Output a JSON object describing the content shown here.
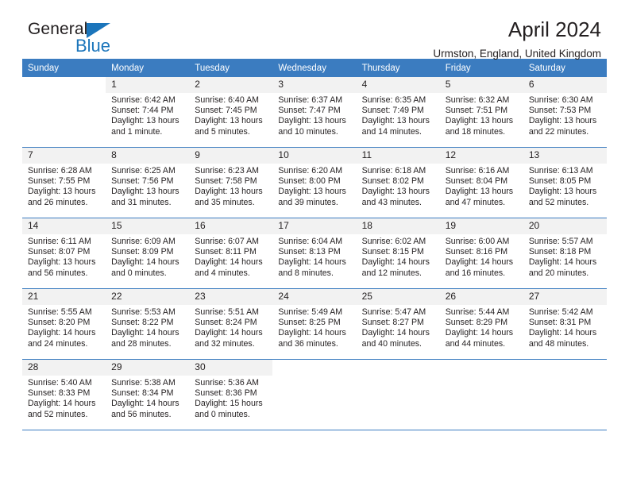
{
  "brand": {
    "name_dark": "General",
    "name_blue": "Blue",
    "accent_color": "#1b75bb"
  },
  "header": {
    "title": "April 2024",
    "subtitle": "Urmston, England, United Kingdom",
    "header_bg": "#3b7cc0",
    "daynum_bg": "#f2f2f2"
  },
  "weekdays": [
    "Sunday",
    "Monday",
    "Tuesday",
    "Wednesday",
    "Thursday",
    "Friday",
    "Saturday"
  ],
  "weeks": [
    [
      {
        "day": "",
        "sunrise": "",
        "sunset": "",
        "daylight": "",
        "blank": true
      },
      {
        "day": "1",
        "sunrise": "Sunrise: 6:42 AM",
        "sunset": "Sunset: 7:44 PM",
        "daylight": "Daylight: 13 hours and 1 minute."
      },
      {
        "day": "2",
        "sunrise": "Sunrise: 6:40 AM",
        "sunset": "Sunset: 7:45 PM",
        "daylight": "Daylight: 13 hours and 5 minutes."
      },
      {
        "day": "3",
        "sunrise": "Sunrise: 6:37 AM",
        "sunset": "Sunset: 7:47 PM",
        "daylight": "Daylight: 13 hours and 10 minutes."
      },
      {
        "day": "4",
        "sunrise": "Sunrise: 6:35 AM",
        "sunset": "Sunset: 7:49 PM",
        "daylight": "Daylight: 13 hours and 14 minutes."
      },
      {
        "day": "5",
        "sunrise": "Sunrise: 6:32 AM",
        "sunset": "Sunset: 7:51 PM",
        "daylight": "Daylight: 13 hours and 18 minutes."
      },
      {
        "day": "6",
        "sunrise": "Sunrise: 6:30 AM",
        "sunset": "Sunset: 7:53 PM",
        "daylight": "Daylight: 13 hours and 22 minutes."
      }
    ],
    [
      {
        "day": "7",
        "sunrise": "Sunrise: 6:28 AM",
        "sunset": "Sunset: 7:55 PM",
        "daylight": "Daylight: 13 hours and 26 minutes."
      },
      {
        "day": "8",
        "sunrise": "Sunrise: 6:25 AM",
        "sunset": "Sunset: 7:56 PM",
        "daylight": "Daylight: 13 hours and 31 minutes."
      },
      {
        "day": "9",
        "sunrise": "Sunrise: 6:23 AM",
        "sunset": "Sunset: 7:58 PM",
        "daylight": "Daylight: 13 hours and 35 minutes."
      },
      {
        "day": "10",
        "sunrise": "Sunrise: 6:20 AM",
        "sunset": "Sunset: 8:00 PM",
        "daylight": "Daylight: 13 hours and 39 minutes."
      },
      {
        "day": "11",
        "sunrise": "Sunrise: 6:18 AM",
        "sunset": "Sunset: 8:02 PM",
        "daylight": "Daylight: 13 hours and 43 minutes."
      },
      {
        "day": "12",
        "sunrise": "Sunrise: 6:16 AM",
        "sunset": "Sunset: 8:04 PM",
        "daylight": "Daylight: 13 hours and 47 minutes."
      },
      {
        "day": "13",
        "sunrise": "Sunrise: 6:13 AM",
        "sunset": "Sunset: 8:05 PM",
        "daylight": "Daylight: 13 hours and 52 minutes."
      }
    ],
    [
      {
        "day": "14",
        "sunrise": "Sunrise: 6:11 AM",
        "sunset": "Sunset: 8:07 PM",
        "daylight": "Daylight: 13 hours and 56 minutes."
      },
      {
        "day": "15",
        "sunrise": "Sunrise: 6:09 AM",
        "sunset": "Sunset: 8:09 PM",
        "daylight": "Daylight: 14 hours and 0 minutes."
      },
      {
        "day": "16",
        "sunrise": "Sunrise: 6:07 AM",
        "sunset": "Sunset: 8:11 PM",
        "daylight": "Daylight: 14 hours and 4 minutes."
      },
      {
        "day": "17",
        "sunrise": "Sunrise: 6:04 AM",
        "sunset": "Sunset: 8:13 PM",
        "daylight": "Daylight: 14 hours and 8 minutes."
      },
      {
        "day": "18",
        "sunrise": "Sunrise: 6:02 AM",
        "sunset": "Sunset: 8:15 PM",
        "daylight": "Daylight: 14 hours and 12 minutes."
      },
      {
        "day": "19",
        "sunrise": "Sunrise: 6:00 AM",
        "sunset": "Sunset: 8:16 PM",
        "daylight": "Daylight: 14 hours and 16 minutes."
      },
      {
        "day": "20",
        "sunrise": "Sunrise: 5:57 AM",
        "sunset": "Sunset: 8:18 PM",
        "daylight": "Daylight: 14 hours and 20 minutes."
      }
    ],
    [
      {
        "day": "21",
        "sunrise": "Sunrise: 5:55 AM",
        "sunset": "Sunset: 8:20 PM",
        "daylight": "Daylight: 14 hours and 24 minutes."
      },
      {
        "day": "22",
        "sunrise": "Sunrise: 5:53 AM",
        "sunset": "Sunset: 8:22 PM",
        "daylight": "Daylight: 14 hours and 28 minutes."
      },
      {
        "day": "23",
        "sunrise": "Sunrise: 5:51 AM",
        "sunset": "Sunset: 8:24 PM",
        "daylight": "Daylight: 14 hours and 32 minutes."
      },
      {
        "day": "24",
        "sunrise": "Sunrise: 5:49 AM",
        "sunset": "Sunset: 8:25 PM",
        "daylight": "Daylight: 14 hours and 36 minutes."
      },
      {
        "day": "25",
        "sunrise": "Sunrise: 5:47 AM",
        "sunset": "Sunset: 8:27 PM",
        "daylight": "Daylight: 14 hours and 40 minutes."
      },
      {
        "day": "26",
        "sunrise": "Sunrise: 5:44 AM",
        "sunset": "Sunset: 8:29 PM",
        "daylight": "Daylight: 14 hours and 44 minutes."
      },
      {
        "day": "27",
        "sunrise": "Sunrise: 5:42 AM",
        "sunset": "Sunset: 8:31 PM",
        "daylight": "Daylight: 14 hours and 48 minutes."
      }
    ],
    [
      {
        "day": "28",
        "sunrise": "Sunrise: 5:40 AM",
        "sunset": "Sunset: 8:33 PM",
        "daylight": "Daylight: 14 hours and 52 minutes."
      },
      {
        "day": "29",
        "sunrise": "Sunrise: 5:38 AM",
        "sunset": "Sunset: 8:34 PM",
        "daylight": "Daylight: 14 hours and 56 minutes."
      },
      {
        "day": "30",
        "sunrise": "Sunrise: 5:36 AM",
        "sunset": "Sunset: 8:36 PM",
        "daylight": "Daylight: 15 hours and 0 minutes."
      },
      {
        "day": "",
        "sunrise": "",
        "sunset": "",
        "daylight": "",
        "blank": true
      },
      {
        "day": "",
        "sunrise": "",
        "sunset": "",
        "daylight": "",
        "blank": true
      },
      {
        "day": "",
        "sunrise": "",
        "sunset": "",
        "daylight": "",
        "blank": true
      },
      {
        "day": "",
        "sunrise": "",
        "sunset": "",
        "daylight": "",
        "blank": true
      }
    ]
  ]
}
